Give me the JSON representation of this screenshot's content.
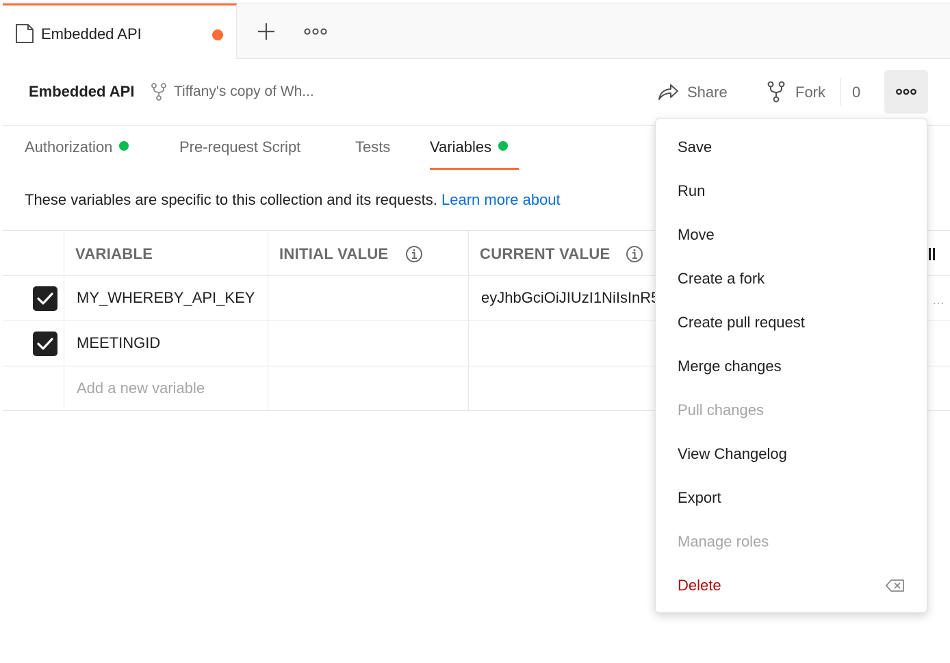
{
  "tab": {
    "label": "Embedded API"
  },
  "header": {
    "title": "Embedded API",
    "fork_source": "Tiffany's copy of Wh...",
    "share_label": "Share",
    "fork_label": "Fork",
    "fork_count": "0"
  },
  "subtabs": [
    {
      "label": "Authorization",
      "dot": true
    },
    {
      "label": "Pre-request Script",
      "dot": false
    },
    {
      "label": "Tests",
      "dot": false
    },
    {
      "label": "Variables",
      "dot": true,
      "active": true
    }
  ],
  "description": {
    "text": "These variables are specific to this collection and its requests.",
    "link": "Learn more about"
  },
  "table": {
    "headers": [
      "VARIABLE",
      "INITIAL VALUE",
      "CURRENT VALUE"
    ],
    "rows": [
      {
        "checked": true,
        "variable": "MY_WHEREBY_API_KEY",
        "initial": "",
        "current": "eyJhbGciOiJIUzI1NiIsInR5cCI6IkpXVCJ9"
      },
      {
        "checked": true,
        "variable": "MEETINGID",
        "initial": "",
        "current": ""
      }
    ],
    "new_placeholder": "Add a new variable"
  },
  "menu": {
    "items": [
      {
        "label": "Save",
        "state": "normal"
      },
      {
        "label": "Run",
        "state": "normal"
      },
      {
        "label": "Move",
        "state": "normal"
      },
      {
        "label": "Create a fork",
        "state": "normal"
      },
      {
        "label": "Create pull request",
        "state": "normal"
      },
      {
        "label": "Merge changes",
        "state": "normal"
      },
      {
        "label": "Pull changes",
        "state": "disabled"
      },
      {
        "label": "View Changelog",
        "state": "normal"
      },
      {
        "label": "Export",
        "state": "normal"
      },
      {
        "label": "Manage roles",
        "state": "disabled"
      },
      {
        "label": "Delete",
        "state": "danger"
      }
    ]
  },
  "colors": {
    "accent": "#ff6c37",
    "success_dot": "#0cbb52",
    "link": "#0b6fd1",
    "danger": "#b10a0a"
  },
  "icons": [
    "collection-doc-icon",
    "plus-icon",
    "more-horizontal-icon",
    "fork-icon",
    "share-icon",
    "info-icon",
    "checkbox-checked-icon",
    "backspace-icon"
  ]
}
